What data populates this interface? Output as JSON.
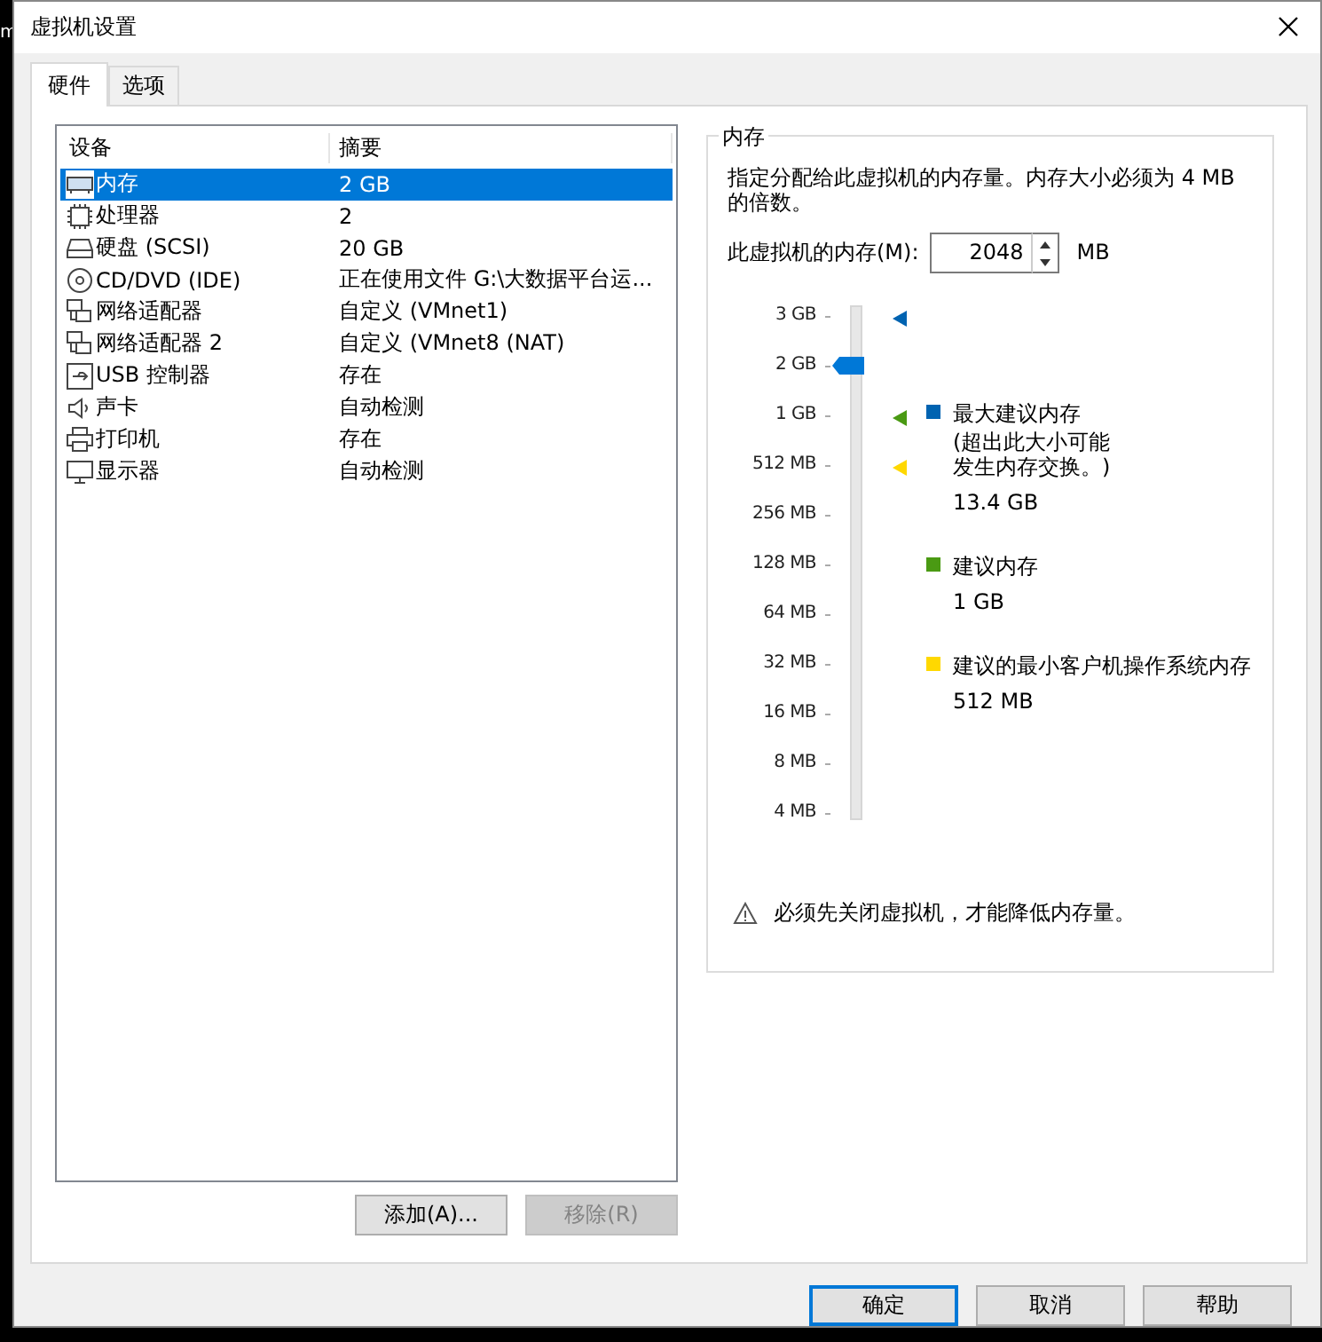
{
  "background_text": "m",
  "window": {
    "title": "虚拟机设置"
  },
  "tabs": [
    {
      "label": "硬件",
      "selected": true
    },
    {
      "label": "选项",
      "selected": false
    }
  ],
  "device_list": {
    "columns": [
      "设备",
      "摘要"
    ],
    "rows": [
      {
        "kind": "memory",
        "device": "内存",
        "summary": "2 GB",
        "selected": true
      },
      {
        "kind": "processor",
        "device": "处理器",
        "summary": "2",
        "selected": false
      },
      {
        "kind": "disk",
        "device": "硬盘 (SCSI)",
        "summary": "20 GB",
        "selected": false
      },
      {
        "kind": "cd",
        "device": "CD/DVD (IDE)",
        "summary": "正在使用文件 G:\\大数据平台运...",
        "selected": false
      },
      {
        "kind": "network",
        "device": "网络适配器",
        "summary": "自定义 (VMnet1)",
        "selected": false
      },
      {
        "kind": "network",
        "device": "网络适配器 2",
        "summary": "自定义 (VMnet8 (NAT)",
        "selected": false
      },
      {
        "kind": "usb",
        "device": "USB 控制器",
        "summary": "存在",
        "selected": false
      },
      {
        "kind": "sound",
        "device": "声卡",
        "summary": "自动检测",
        "selected": false
      },
      {
        "kind": "printer",
        "device": "打印机",
        "summary": "存在",
        "selected": false
      },
      {
        "kind": "display",
        "device": "显示器",
        "summary": "自动检测",
        "selected": false
      }
    ]
  },
  "list_buttons": [
    {
      "label": "添加(A)...",
      "disabled": false
    },
    {
      "label": "移除(R)",
      "disabled": true
    }
  ],
  "memory_group": {
    "title": "内存",
    "description": "指定分配给此虚拟机的内存量。内存大小必须为 4 MB 的倍数。",
    "field_label": "此虚拟机的内存(M):",
    "value": "2048",
    "unit": "MB",
    "slider": {
      "level": 0.9,
      "ticks": [
        {
          "label": "3 GB",
          "marker": {
            "color": "#0063b1"
          }
        },
        {
          "label": "2 GB"
        },
        {
          "label": "1 GB",
          "marker": {
            "color": "#4a9a13"
          }
        },
        {
          "label": "512 MB",
          "marker": {
            "color": "#ffd800"
          }
        },
        {
          "label": "256 MB"
        },
        {
          "label": "128 MB"
        },
        {
          "label": "64 MB"
        },
        {
          "label": "32 MB"
        },
        {
          "label": "16 MB"
        },
        {
          "label": "8 MB"
        },
        {
          "label": "4 MB"
        }
      ]
    },
    "legend": [
      {
        "color": "#0063b1",
        "label": "最大建议内存",
        "note_lines": [
          "(超出此大小可能",
          "发生内存交换。)"
        ],
        "value": "13.4 GB"
      },
      {
        "color": "#4a9a13",
        "label": "建议内存",
        "value": "1 GB"
      },
      {
        "color": "#ffd800",
        "label": "建议的最小客户机操作系统内存",
        "value": "512 MB"
      }
    ],
    "warning": "必须先关闭虚拟机，才能降低内存量。"
  },
  "buttons": [
    {
      "label": "确定",
      "default": true
    },
    {
      "label": "取消",
      "default": false
    },
    {
      "label": "帮助",
      "default": false
    }
  ]
}
